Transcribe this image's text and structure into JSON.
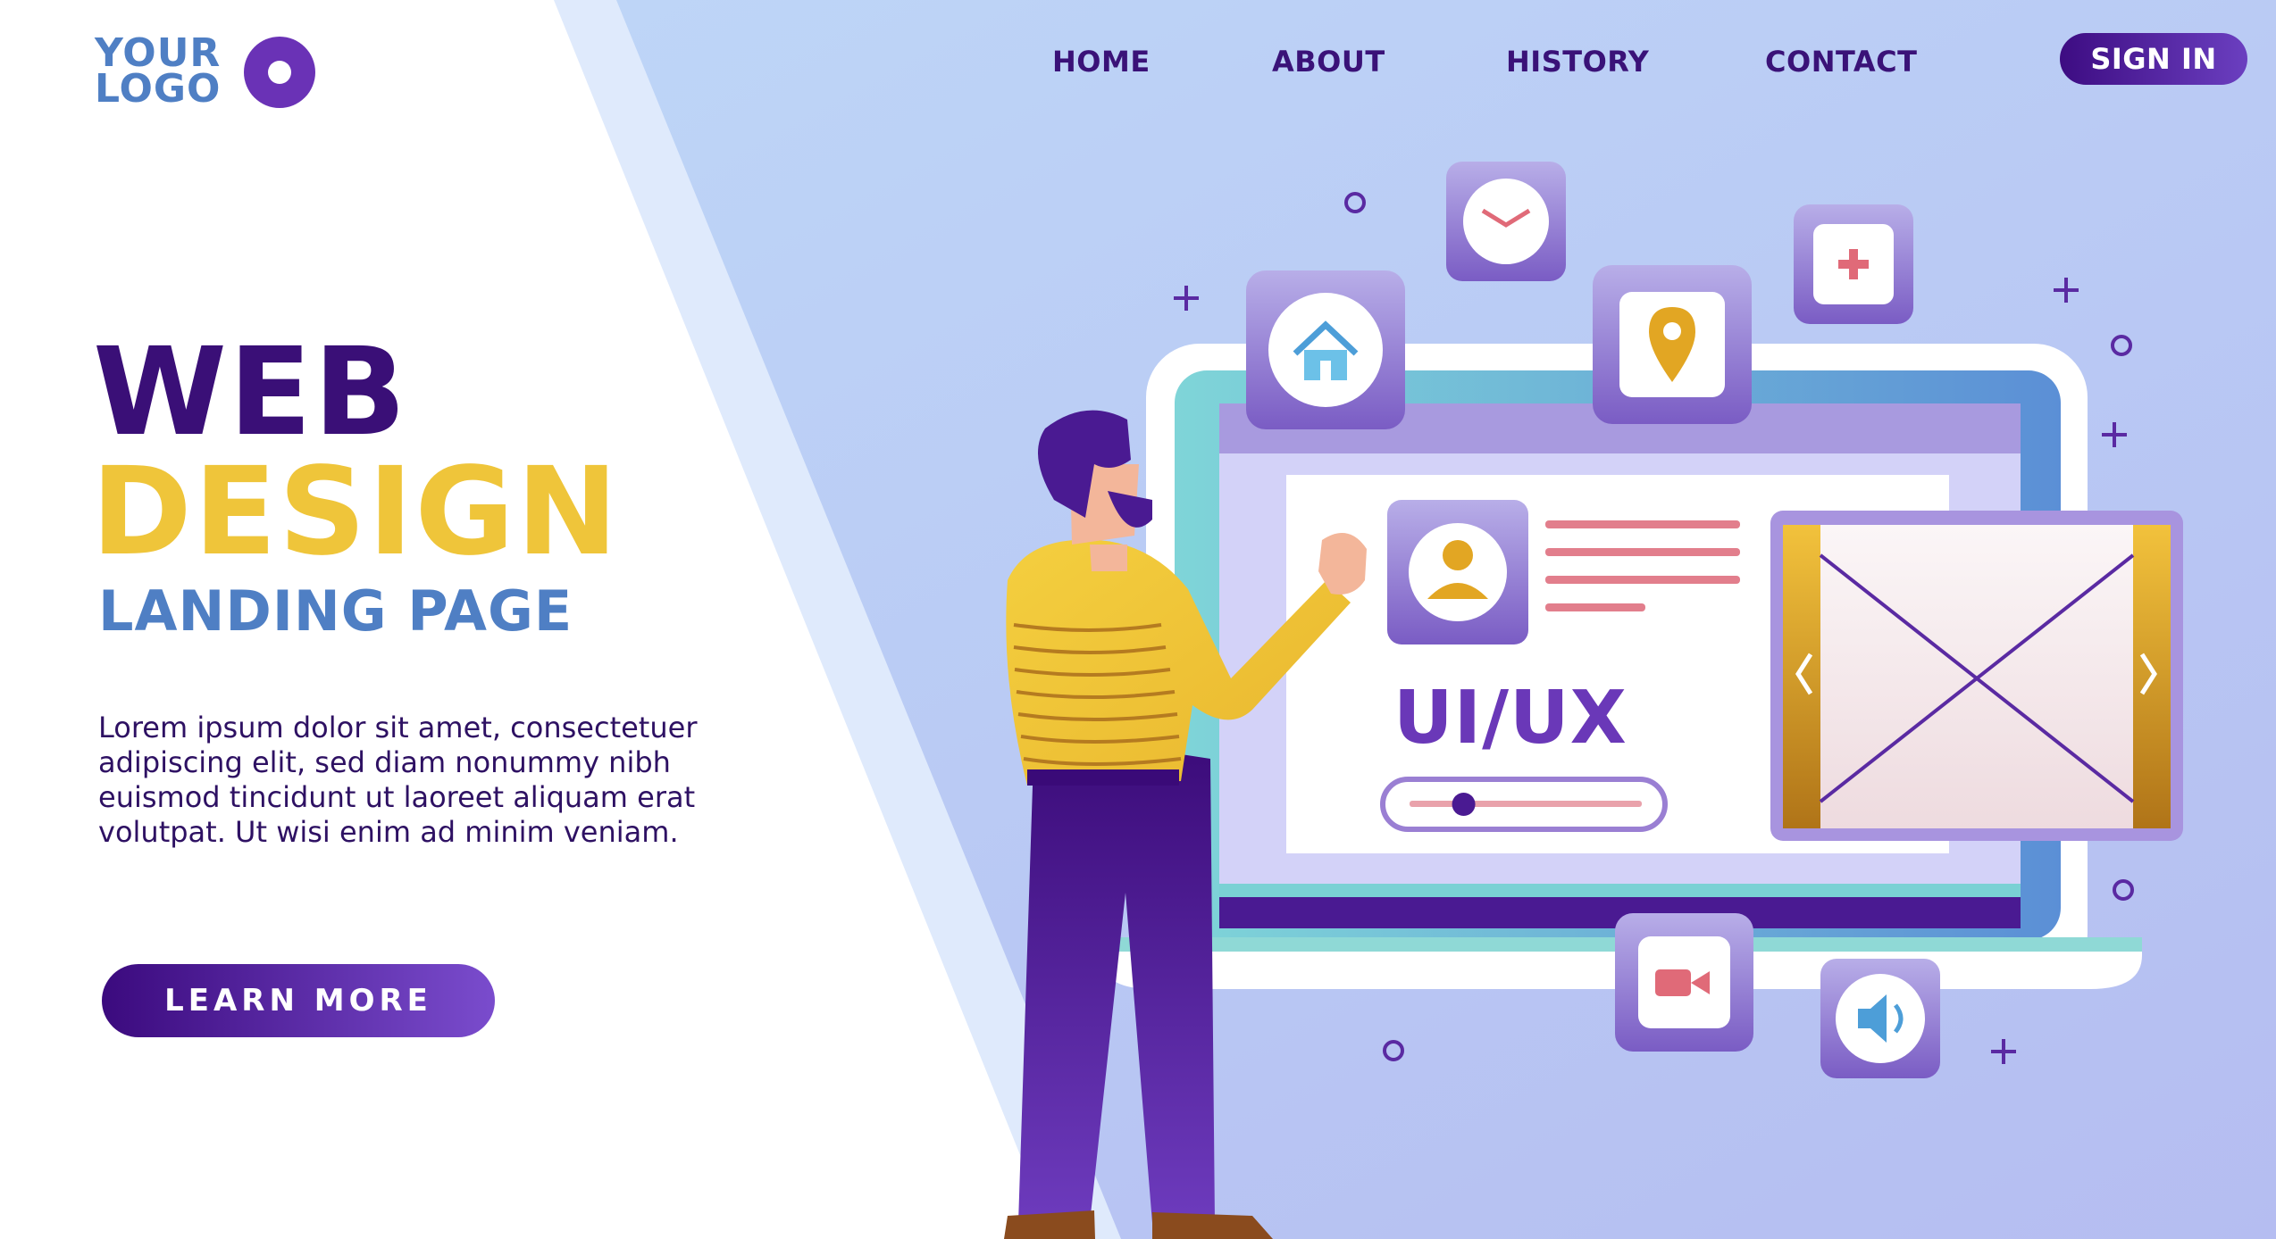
{
  "logo": {
    "line1": "YOUR",
    "line2": "LOGO"
  },
  "nav": {
    "items": [
      {
        "label": "HOME"
      },
      {
        "label": "ABOUT"
      },
      {
        "label": "HISTORY"
      },
      {
        "label": "CONTACT"
      }
    ],
    "sign_in": "SIGN IN"
  },
  "hero": {
    "line1": "WEB",
    "line2": "DESIGN",
    "line3": "LANDING PAGE",
    "body": "Lorem ipsum dolor sit amet, consectetuer adipiscing elit, sed diam nonummy nibh euismod tincidunt ut laoreet aliquam erat volutpat. Ut wisi enim ad minim veniam.",
    "cta": "LEARN MORE"
  },
  "illustration": {
    "screen_label": "UI/UX",
    "slider_value": 0.22,
    "icons": [
      "clock-icon",
      "house-icon",
      "location-pin-icon",
      "plus-icon",
      "user-icon",
      "video-camera-icon",
      "speaker-icon",
      "chevron-left-icon",
      "chevron-right-icon"
    ]
  },
  "colors": {
    "primary_dark": "#3a0f77",
    "accent_yellow": "#efc53a",
    "accent_blue": "#4f7fc4",
    "button_purple": "#6b3fc0",
    "background_blue": "#c3d6f7"
  }
}
